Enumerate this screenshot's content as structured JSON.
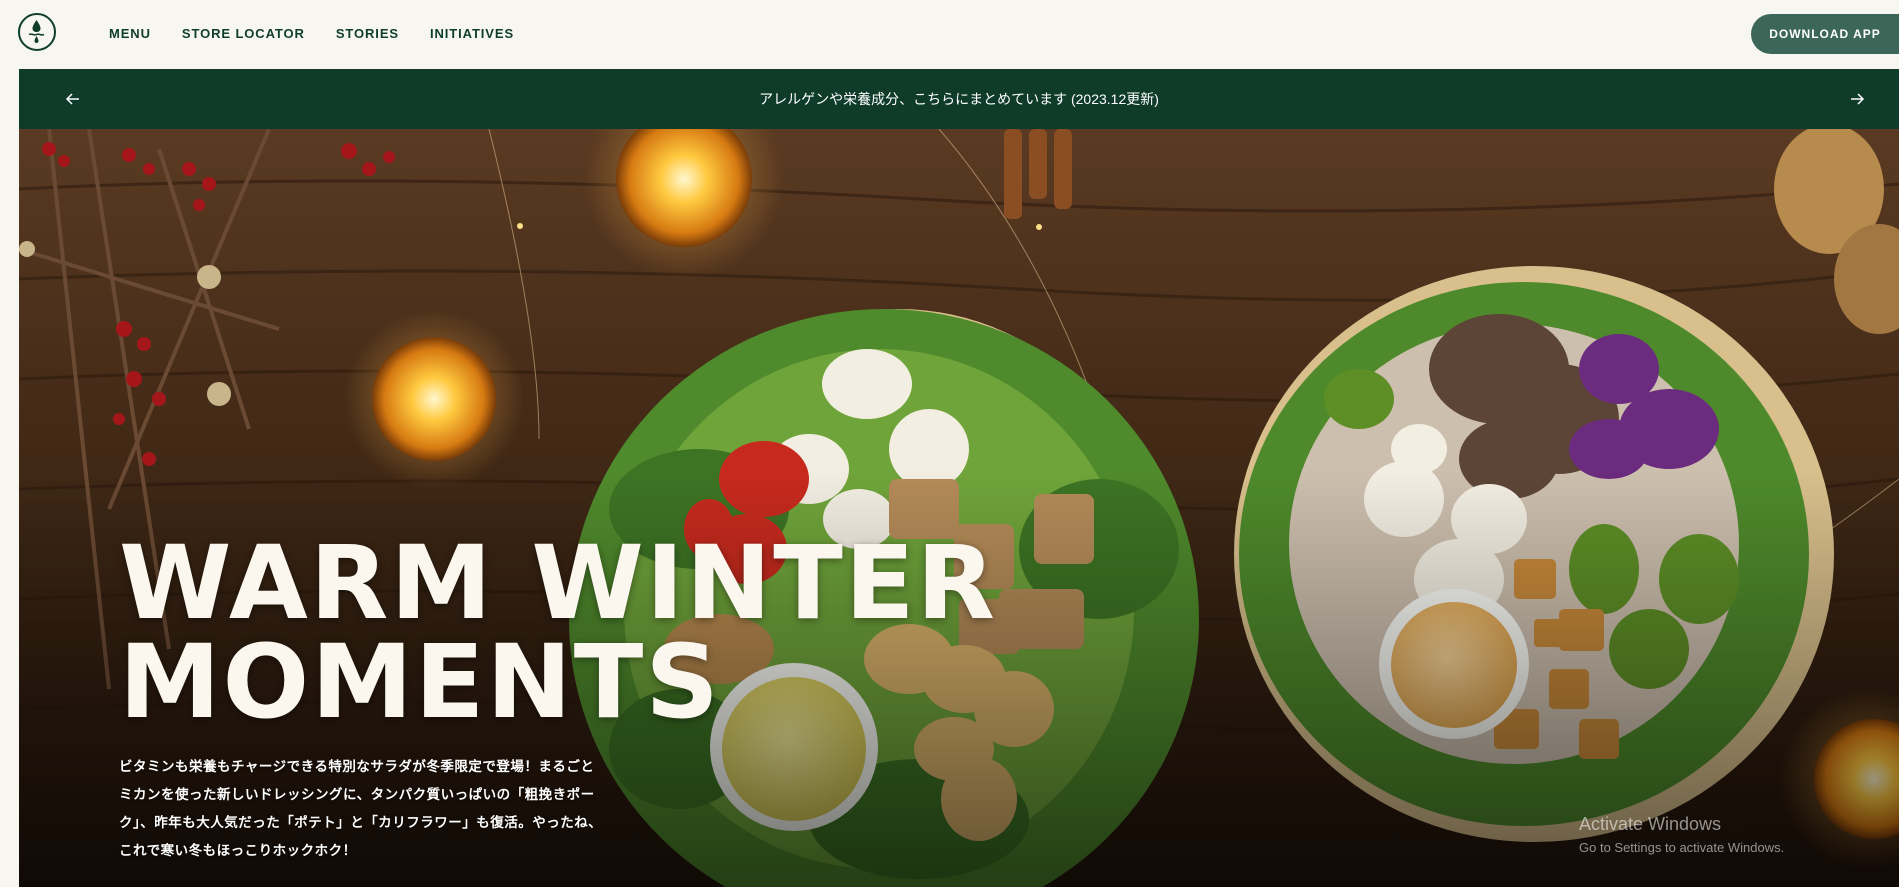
{
  "nav": {
    "logo_icon": "leaf-drop-logo-icon",
    "items": [
      "MENU",
      "STORE LOCATOR",
      "STORIES",
      "INITIATIVES"
    ],
    "download_label": "DOWNLOAD APP"
  },
  "banner": {
    "message": "アレルゲンや栄養成分、こちらにまとめています (2023.12更新)",
    "prev_icon": "arrow-left-icon",
    "next_icon": "arrow-right-icon"
  },
  "hero": {
    "headline": "WARM WINTER\nMOMENTS",
    "description": "ビタミンも栄養もチャージできる特別なサラダが冬季限定で登場！まるごとミカンを使った新しいドレッシングに、タンパク質いっぱいの「粗挽きポーク」、昨年も大人気だった「ポテト」と「カリフラワー」も復活。やったね、これで寒い冬もほっこりホックホク！"
  },
  "os_watermark": {
    "title": "Activate Windows",
    "subtitle": "Go to Settings to activate Windows."
  },
  "colors": {
    "brand_green": "#0e3b2a",
    "button_green": "#3c6658",
    "background": "#f8f6f1"
  }
}
